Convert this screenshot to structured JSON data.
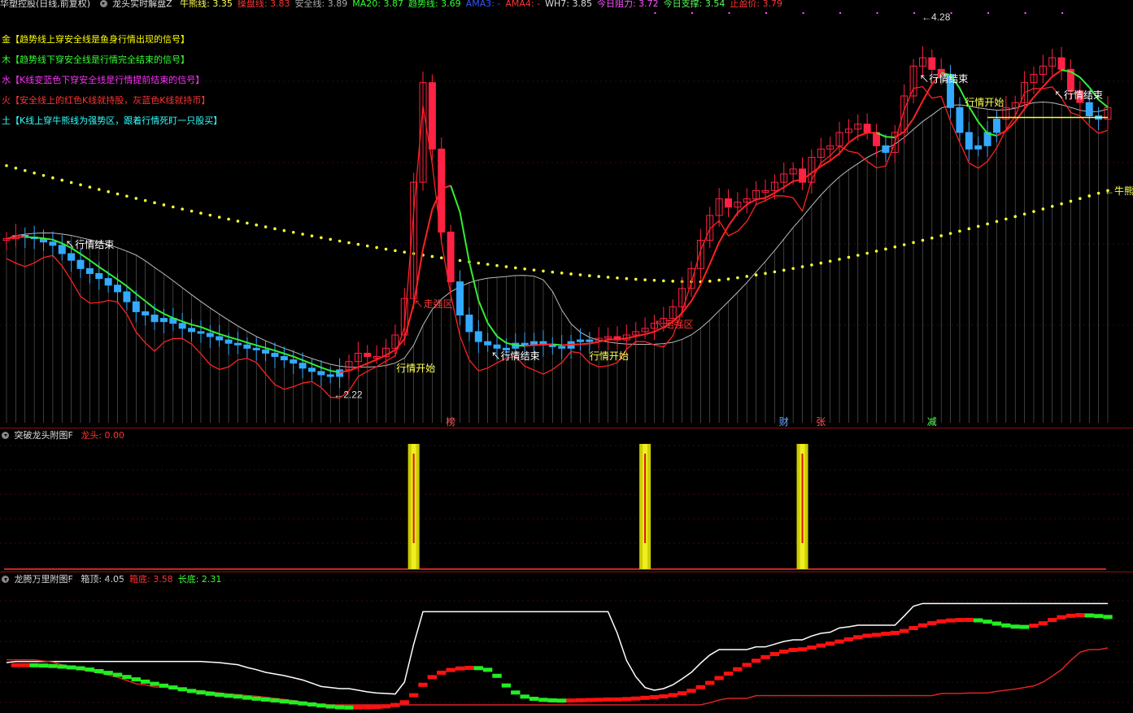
{
  "main_header": {
    "stock": "华塑控股(日线,前复权)",
    "indicator": "龙头实时解盘Z",
    "fields": [
      {
        "label": "牛熊线: 3.35",
        "color": "#ffff55"
      },
      {
        "label": "操盘线: 3.83",
        "color": "#ff3333"
      },
      {
        "label": "安全线: 3.89",
        "color": "#aaaaaa"
      },
      {
        "label": "MA20: 3.87",
        "color": "#33ff33"
      },
      {
        "label": "趋势线: 3.69",
        "color": "#33ff33"
      },
      {
        "label": "AMA3: -",
        "color": "#3355ff"
      },
      {
        "label": "AMA4: -",
        "color": "#ff3333"
      },
      {
        "label": "WH7: 3.85",
        "color": "#dddddd"
      },
      {
        "label": "今日阻力: 3.72",
        "color": "#ff55ff"
      },
      {
        "label": "今日支撑: 3.54",
        "color": "#55ff55"
      },
      {
        "label": "止盈价: 3.79",
        "color": "#ff3333"
      }
    ]
  },
  "legend": [
    {
      "text": "金【趋势线上穿安全线是鱼身行情出现的信号】",
      "color": "#ffff00"
    },
    {
      "text": "木【趋势线下穿安全线是行情完全结束的信号】",
      "color": "#33ff33"
    },
    {
      "text": "水【K线变蓝色下穿安全线是行情提前结束的信号】",
      "color": "#ff33ff"
    },
    {
      "text": "火【安全线上的红色K线就持股，灰蓝色K线就持币】",
      "color": "#ff3333"
    },
    {
      "text": "土【K线上穿牛熊线为强势区，跟着行情死盯一只股买】",
      "color": "#33ffff"
    }
  ],
  "annotations": {
    "high": "4.28",
    "low": "2.22",
    "market_end": "行情结束",
    "market_start": "行情开始",
    "strong_zone": "走强区",
    "bull_bear_line": "牛熊线",
    "market_end_short": "行情结束"
  },
  "bottom_markers": [
    {
      "label": "榜",
      "color": "#ff5555"
    },
    {
      "label": "财",
      "color": "#66aaff"
    },
    {
      "label": "张",
      "color": "#ff5555"
    },
    {
      "label": "减",
      "color": "#55ff55"
    }
  ],
  "sub1_header": {
    "name": "突破龙头附图F",
    "fields": [
      {
        "label": "龙头: 0.00",
        "color": "#ff3333"
      }
    ]
  },
  "sub2_header": {
    "name": "龙腾万里附图F",
    "fields": [
      {
        "label": "箱顶: 4.05",
        "color": "#dddddd"
      },
      {
        "label": "箱底: 3.58",
        "color": "#ff3333"
      },
      {
        "label": "长底: 2.31",
        "color": "#33ff33"
      }
    ]
  },
  "chart_data": [
    {
      "type": "candlestick",
      "title": "龙头实时解盘Z",
      "ylim": [
        2.0,
        4.4
      ],
      "high_label": 4.28,
      "low_label": 2.22,
      "n_bars": 120,
      "close": [
        3.06,
        3.08,
        3.07,
        3.06,
        3.04,
        3.02,
        2.97,
        2.93,
        2.88,
        2.85,
        2.82,
        2.78,
        2.74,
        2.68,
        2.62,
        2.6,
        2.56,
        2.58,
        2.55,
        2.52,
        2.5,
        2.49,
        2.47,
        2.45,
        2.43,
        2.42,
        2.4,
        2.39,
        2.37,
        2.35,
        2.33,
        2.31,
        2.28,
        2.26,
        2.24,
        2.23,
        2.27,
        2.32,
        2.37,
        2.35,
        2.35,
        2.4,
        2.48,
        2.7,
        3.4,
        4.0,
        3.6,
        3.1,
        2.8,
        2.6,
        2.5,
        2.44,
        2.42,
        2.4,
        2.4,
        2.43,
        2.42,
        2.44,
        2.42,
        2.41,
        2.4,
        2.44,
        2.45,
        2.44,
        2.46,
        2.47,
        2.45,
        2.48,
        2.5,
        2.52,
        2.55,
        2.58,
        2.65,
        2.76,
        2.88,
        3.05,
        3.2,
        3.3,
        3.25,
        3.28,
        3.3,
        3.35,
        3.35,
        3.4,
        3.45,
        3.48,
        3.4,
        3.55,
        3.6,
        3.62,
        3.7,
        3.72,
        3.75,
        3.7,
        3.62,
        3.58,
        3.7,
        3.92,
        4.1,
        4.15,
        4.08,
        4.05,
        3.85,
        3.7,
        3.6,
        3.62,
        3.7,
        3.78,
        3.85,
        3.88,
        4.0,
        4.05,
        4.1,
        4.15,
        4.08,
        3.95,
        3.88,
        3.8,
        3.78,
        3.85
      ],
      "bull_bear_line": {
        "start": 3.5,
        "min": 2.8,
        "end": 3.35
      },
      "values_at_last_bar": {
        "牛熊线": 3.35,
        "操盘线": 3.83,
        "安全线": 3.89,
        "MA20": 3.87,
        "趋势线": 3.69,
        "WH7": 3.85,
        "今日阻力": 3.72,
        "今日支撑": 3.54,
        "止盈价": 3.79
      }
    },
    {
      "type": "bar",
      "title": "突破龙头附图F",
      "series": [
        {
          "name": "龙头",
          "values": [
            1,
            1,
            1
          ]
        }
      ],
      "bar_positions_bar_index": [
        44,
        69,
        86
      ],
      "value_at_last_bar": 0.0
    },
    {
      "type": "line",
      "title": "龙腾万里附图F",
      "series": [
        {
          "name": "箱顶",
          "last": 4.05
        },
        {
          "name": "箱底",
          "last": 3.58
        },
        {
          "name": "长底",
          "last": 2.31
        }
      ]
    }
  ]
}
